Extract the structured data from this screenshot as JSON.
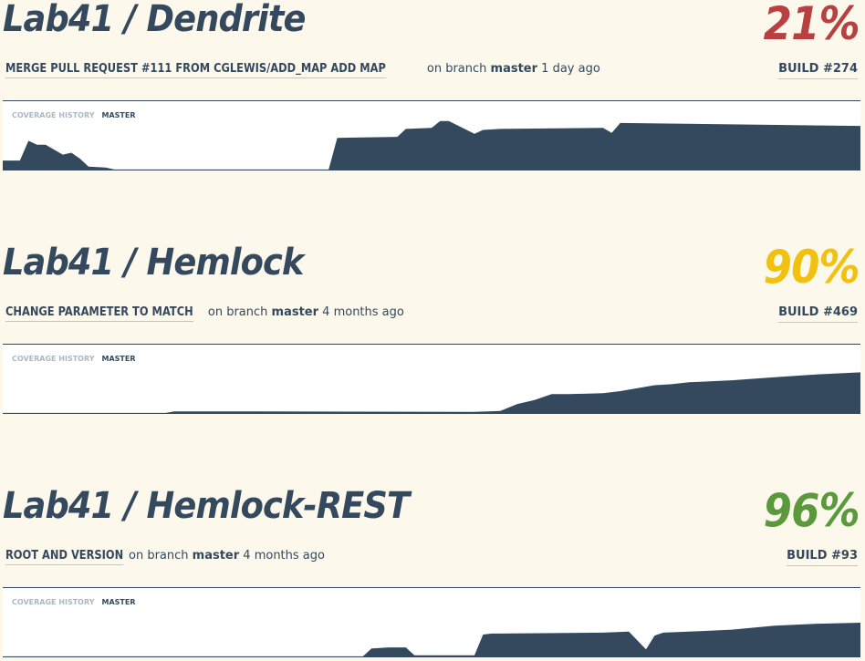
{
  "tabs": {
    "history": "COVERAGE HISTORY",
    "master": "MASTER"
  },
  "repos": [
    {
      "title": "Lab41 / Dendrite",
      "coverage": "21%",
      "coverage_color": "#b84040",
      "commit": "MERGE PULL REQUEST #111 FROM CGLEWIS/ADD_MAP ADD MAP",
      "on_branch": "on branch",
      "branch": "master",
      "ago": "1 day ago",
      "build": "BUILD #274"
    },
    {
      "title": "Lab41 / Hemlock",
      "coverage": "90%",
      "coverage_color": "#f2c10f",
      "commit": "CHANGE PARAMETER TO MATCH",
      "on_branch": "on branch",
      "branch": "master",
      "ago": "4 months ago",
      "build": "BUILD #469"
    },
    {
      "title": "Lab41 / Hemlock-REST",
      "coverage": "96%",
      "coverage_color": "#5a9a3c",
      "commit": "ROOT AND VERSION",
      "on_branch": "on branch",
      "branch": "master",
      "ago": "4 months ago",
      "build": "BUILD #93"
    }
  ],
  "colors": {
    "chart_fill": "#34495e",
    "background": "#fcf8ec"
  },
  "chart_data": [
    {
      "type": "area",
      "title": "",
      "x": [
        0,
        2,
        3,
        4,
        5,
        7,
        8,
        9,
        10,
        12,
        13,
        20,
        38,
        39,
        46,
        47,
        50,
        51,
        52,
        55,
        56,
        58,
        70,
        71,
        72,
        100
      ],
      "values": [
        1,
        1,
        3,
        2.6,
        2.6,
        1.6,
        1.8,
        1.2,
        0.4,
        0.3,
        0.1,
        0.1,
        0.1,
        3.3,
        3.4,
        4.2,
        4.3,
        5,
        5,
        3.7,
        4.1,
        4.2,
        4.3,
        3.8,
        4.8,
        4.5
      ],
      "ylim": [
        0,
        7
      ]
    },
    {
      "type": "area",
      "x": [
        0,
        19,
        20,
        30,
        55,
        58,
        60,
        62,
        64,
        66,
        70,
        72,
        74,
        76,
        78,
        80,
        85,
        90,
        95,
        100
      ],
      "values": [
        0.1,
        0.1,
        0.25,
        0.25,
        0.2,
        0.3,
        1.0,
        1.4,
        2.0,
        2.0,
        2.1,
        2.3,
        2.6,
        2.9,
        3.0,
        3.2,
        3.4,
        3.7,
        4.0,
        4.2
      ],
      "ylim": [
        0,
        7
      ]
    },
    {
      "type": "area",
      "x": [
        0,
        42,
        43,
        45,
        47,
        48,
        55,
        56,
        57,
        58,
        70,
        73,
        75,
        76,
        77,
        80,
        85,
        90,
        95,
        100
      ],
      "values": [
        0.1,
        0.1,
        0.9,
        1.0,
        1.0,
        0.2,
        0.2,
        2.3,
        2.4,
        2.4,
        2.5,
        2.6,
        0.8,
        2.2,
        2.5,
        2.6,
        2.8,
        3.2,
        3.4,
        3.5
      ],
      "ylim": [
        0,
        7
      ]
    }
  ]
}
